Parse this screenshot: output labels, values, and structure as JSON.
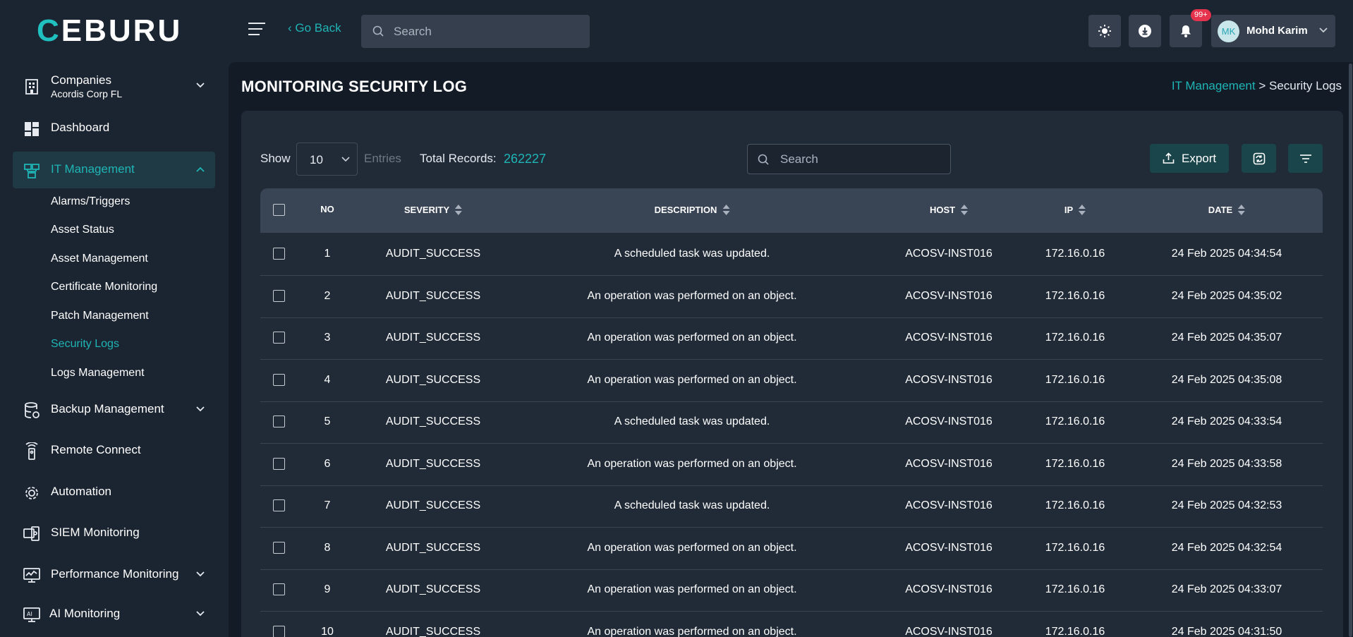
{
  "header": {
    "logo": "CEBURU",
    "go_back": "‹ Go Back",
    "search_placeholder": "Search",
    "notification_badge": "99+",
    "user": {
      "initials": "MK",
      "name": "Mohd Karim"
    }
  },
  "sidebar": {
    "company": {
      "label": "Companies",
      "value": "Acordis Corp FL"
    },
    "dashboard": "Dashboard",
    "it_management": "IT Management",
    "it_sub": [
      "Alarms/Triggers",
      "Asset Status",
      "Asset Management",
      "Certificate Monitoring",
      "Patch Management",
      "Security Logs",
      "Logs Management"
    ],
    "backup": "Backup Management",
    "remote": "Remote Connect",
    "automation": "Automation",
    "siem": "SIEM Monitoring",
    "performance": "Performance Monitoring",
    "ai": "AI Monitoring"
  },
  "page": {
    "title": "MONITORING SECURITY LOG",
    "breadcrumb_parent": "IT Management",
    "breadcrumb_sep": ">",
    "breadcrumb_current": "Security Logs"
  },
  "toolbar": {
    "show_label": "Show",
    "entries_value": "10",
    "entries_label": "Entries",
    "total_label": "Total Records:",
    "total_value": "262227",
    "search_placeholder": "Search",
    "export_label": "Export"
  },
  "table": {
    "columns": [
      "NO",
      "SEVERITY",
      "DESCRIPTION",
      "HOST",
      "IP",
      "DATE"
    ],
    "rows": [
      [
        "1",
        "AUDIT_SUCCESS",
        "A scheduled task was updated.",
        "ACOSV-INST016",
        "172.16.0.16",
        "24 Feb 2025 04:34:54"
      ],
      [
        "2",
        "AUDIT_SUCCESS",
        "An operation was performed on an object.",
        "ACOSV-INST016",
        "172.16.0.16",
        "24 Feb 2025 04:35:02"
      ],
      [
        "3",
        "AUDIT_SUCCESS",
        "An operation was performed on an object.",
        "ACOSV-INST016",
        "172.16.0.16",
        "24 Feb 2025 04:35:07"
      ],
      [
        "4",
        "AUDIT_SUCCESS",
        "An operation was performed on an object.",
        "ACOSV-INST016",
        "172.16.0.16",
        "24 Feb 2025 04:35:08"
      ],
      [
        "5",
        "AUDIT_SUCCESS",
        "A scheduled task was updated.",
        "ACOSV-INST016",
        "172.16.0.16",
        "24 Feb 2025 04:33:54"
      ],
      [
        "6",
        "AUDIT_SUCCESS",
        "An operation was performed on an object.",
        "ACOSV-INST016",
        "172.16.0.16",
        "24 Feb 2025 04:33:58"
      ],
      [
        "7",
        "AUDIT_SUCCESS",
        "A scheduled task was updated.",
        "ACOSV-INST016",
        "172.16.0.16",
        "24 Feb 2025 04:32:53"
      ],
      [
        "8",
        "AUDIT_SUCCESS",
        "An operation was performed on an object.",
        "ACOSV-INST016",
        "172.16.0.16",
        "24 Feb 2025 04:32:54"
      ],
      [
        "9",
        "AUDIT_SUCCESS",
        "An operation was performed on an object.",
        "ACOSV-INST016",
        "172.16.0.16",
        "24 Feb 2025 04:33:07"
      ],
      [
        "10",
        "AUDIT_SUCCESS",
        "An operation was performed on an object.",
        "ACOSV-INST016",
        "172.16.0.16",
        "24 Feb 2025 04:31:50"
      ]
    ]
  },
  "colors": {
    "accent": "#1fb5b5",
    "badge": "#e5334d",
    "background": "#131b27",
    "card": "#212b38"
  }
}
